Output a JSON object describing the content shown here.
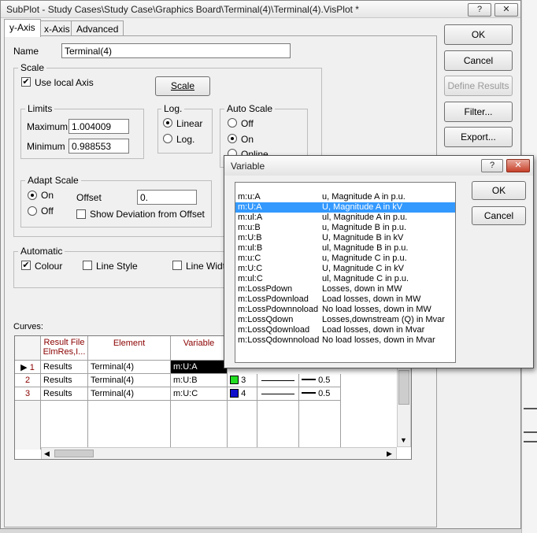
{
  "window": {
    "title": "SubPlot - Study Cases\\Study Case\\Graphics Board\\Terminal(4)\\Terminal(4).VisPlot *",
    "help_glyph": "?",
    "close_glyph": "✕"
  },
  "tabs": [
    {
      "label": "y-Axis",
      "active": true
    },
    {
      "label": "x-Axis",
      "active": false
    },
    {
      "label": "Advanced",
      "active": false
    }
  ],
  "side_buttons": {
    "ok": "OK",
    "cancel": "Cancel",
    "define_results": "Define Results",
    "filter": "Filter...",
    "export": "Export..."
  },
  "name_label": "Name",
  "name_value": "Terminal(4)",
  "scale": {
    "legend": "Scale",
    "use_local_axis_label": "Use local Axis",
    "use_local_axis_checked": true,
    "scale_button": "Scale",
    "limits_legend": "Limits",
    "maximum_label": "Maximum",
    "maximum_value": "1.004009",
    "minimum_label": "Minimum",
    "minimum_value": "0.988553",
    "log_legend": "Log.",
    "linear_label": "Linear",
    "log_label": "Log.",
    "autoscale_legend": "Auto Scale",
    "auto_off": "Off",
    "auto_on": "On",
    "auto_online": "Online",
    "adapt_legend": "Adapt Scale",
    "adapt_on": "On",
    "adapt_off": "Off",
    "offset_label": "Offset",
    "offset_value": "0.",
    "show_deviation_label": "Show Deviation from Offset"
  },
  "automatic": {
    "legend": "Automatic",
    "colour_label": "Colour",
    "colour_checked": true,
    "line_style_label": "Line Style",
    "line_width_label": "Line Width"
  },
  "curves": {
    "label": "Curves:",
    "headers": {
      "result_file": "Result File ElmRes,I...",
      "element": "Element",
      "variable": "Variable"
    },
    "rows": [
      {
        "num": "1",
        "result": "Results",
        "element": "Terminal(4)",
        "variable": "m:U:A",
        "color_index": "",
        "color": "",
        "width": ""
      },
      {
        "num": "2",
        "result": "Results",
        "element": "Terminal(4)",
        "variable": "m:U:B",
        "color_index": "3",
        "color": "#22dd22",
        "width": "0.5"
      },
      {
        "num": "3",
        "result": "Results",
        "element": "Terminal(4)",
        "variable": "m:U:C",
        "color_index": "4",
        "color": "#1010cc",
        "width": "0.5"
      }
    ]
  },
  "variable_dialog": {
    "title": "Variable",
    "ok": "OK",
    "cancel": "Cancel",
    "items": [
      {
        "name": "m:u:A",
        "desc": "u, Magnitude A in p.u.",
        "selected": false
      },
      {
        "name": "m:U:A",
        "desc": "U, Magnitude A in kV",
        "selected": true
      },
      {
        "name": "m:ul:A",
        "desc": "ul, Magnitude A in p.u.",
        "selected": false
      },
      {
        "name": "m:u:B",
        "desc": "u, Magnitude B in p.u.",
        "selected": false
      },
      {
        "name": "m:U:B",
        "desc": "U, Magnitude B in kV",
        "selected": false
      },
      {
        "name": "m:ul:B",
        "desc": "ul, Magnitude B in p.u.",
        "selected": false
      },
      {
        "name": "m:u:C",
        "desc": "u, Magnitude C in p.u.",
        "selected": false
      },
      {
        "name": "m:U:C",
        "desc": "U, Magnitude C in kV",
        "selected": false
      },
      {
        "name": "m:ul:C",
        "desc": "ul, Magnitude C in p.u.",
        "selected": false
      },
      {
        "name": "m:LossPdown",
        "desc": "Losses, down in MW",
        "selected": false
      },
      {
        "name": "m:LossPdownload",
        "desc": "Load losses, down in MW",
        "selected": false
      },
      {
        "name": "m:LossPdownnoload",
        "desc": "No load losses, down in MW",
        "selected": false
      },
      {
        "name": "m:LossQdown",
        "desc": "Losses,downstream (Q) in Mvar",
        "selected": false
      },
      {
        "name": "m:LossQdownload",
        "desc": "Load losses, down in Mvar",
        "selected": false
      },
      {
        "name": "m:LossQdownnoload",
        "desc": "No load losses, down in Mvar",
        "selected": false
      }
    ]
  }
}
